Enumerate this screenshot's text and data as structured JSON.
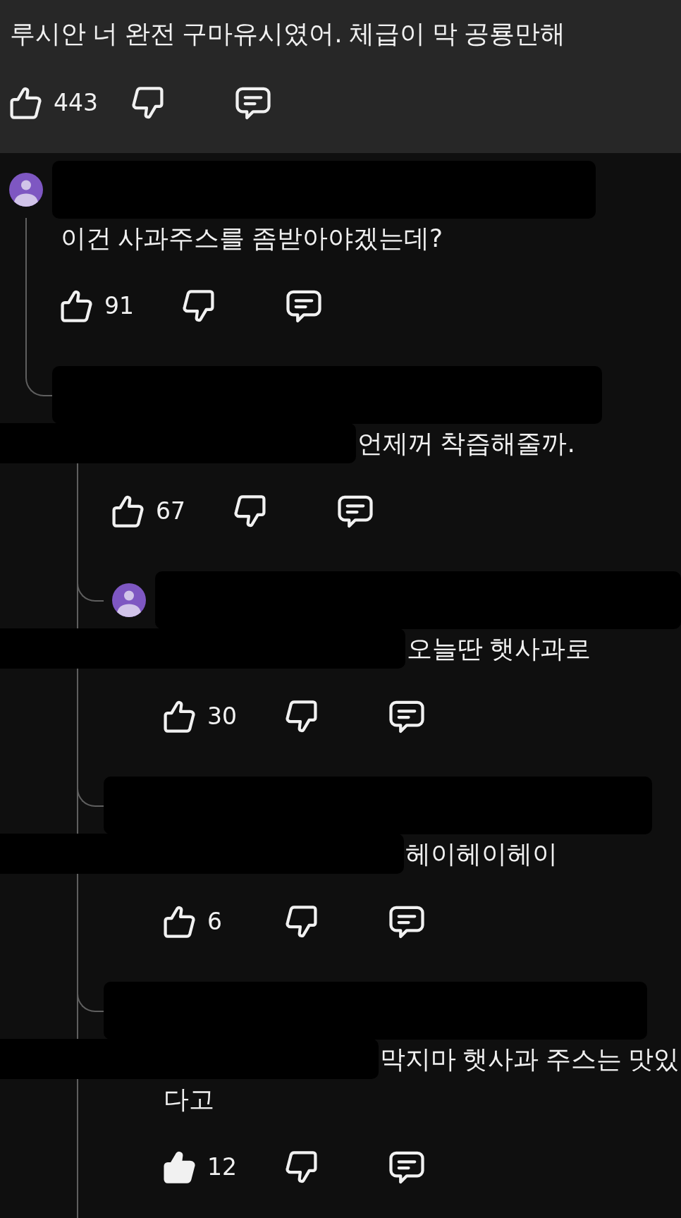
{
  "comment": {
    "text": "루시안 너 완전 구마유시였어. 체급이 막 공룡만해",
    "likes": "443",
    "liked": false
  },
  "replies": [
    {
      "header_redacted": true,
      "avatar_redacted": false,
      "mention_redacted": false,
      "text": "이건 사과주스를 좀받아야겠는데?",
      "likes": "91",
      "liked": false,
      "thread_continues": false,
      "children": [
        {
          "header_redacted": true,
          "avatar_redacted": true,
          "mention_redacted": true,
          "text": "언제꺼 착즙해줄까.",
          "likes": "67",
          "liked": false,
          "thread_continues": true,
          "children": [
            {
              "header_redacted": true,
              "avatar_redacted": false,
              "mention_redacted": true,
              "text": "오늘딴 햇사과로",
              "likes": "30",
              "liked": false
            },
            {
              "header_redacted": true,
              "avatar_redacted": true,
              "mention_redacted": true,
              "text": "헤이헤이헤이",
              "likes": "6",
              "liked": false
            },
            {
              "header_redacted": true,
              "avatar_redacted": true,
              "mention_redacted": true,
              "text": "막지마 햇사과 주스는 맛있다고",
              "likes": "12",
              "liked": true
            }
          ]
        }
      ]
    }
  ]
}
